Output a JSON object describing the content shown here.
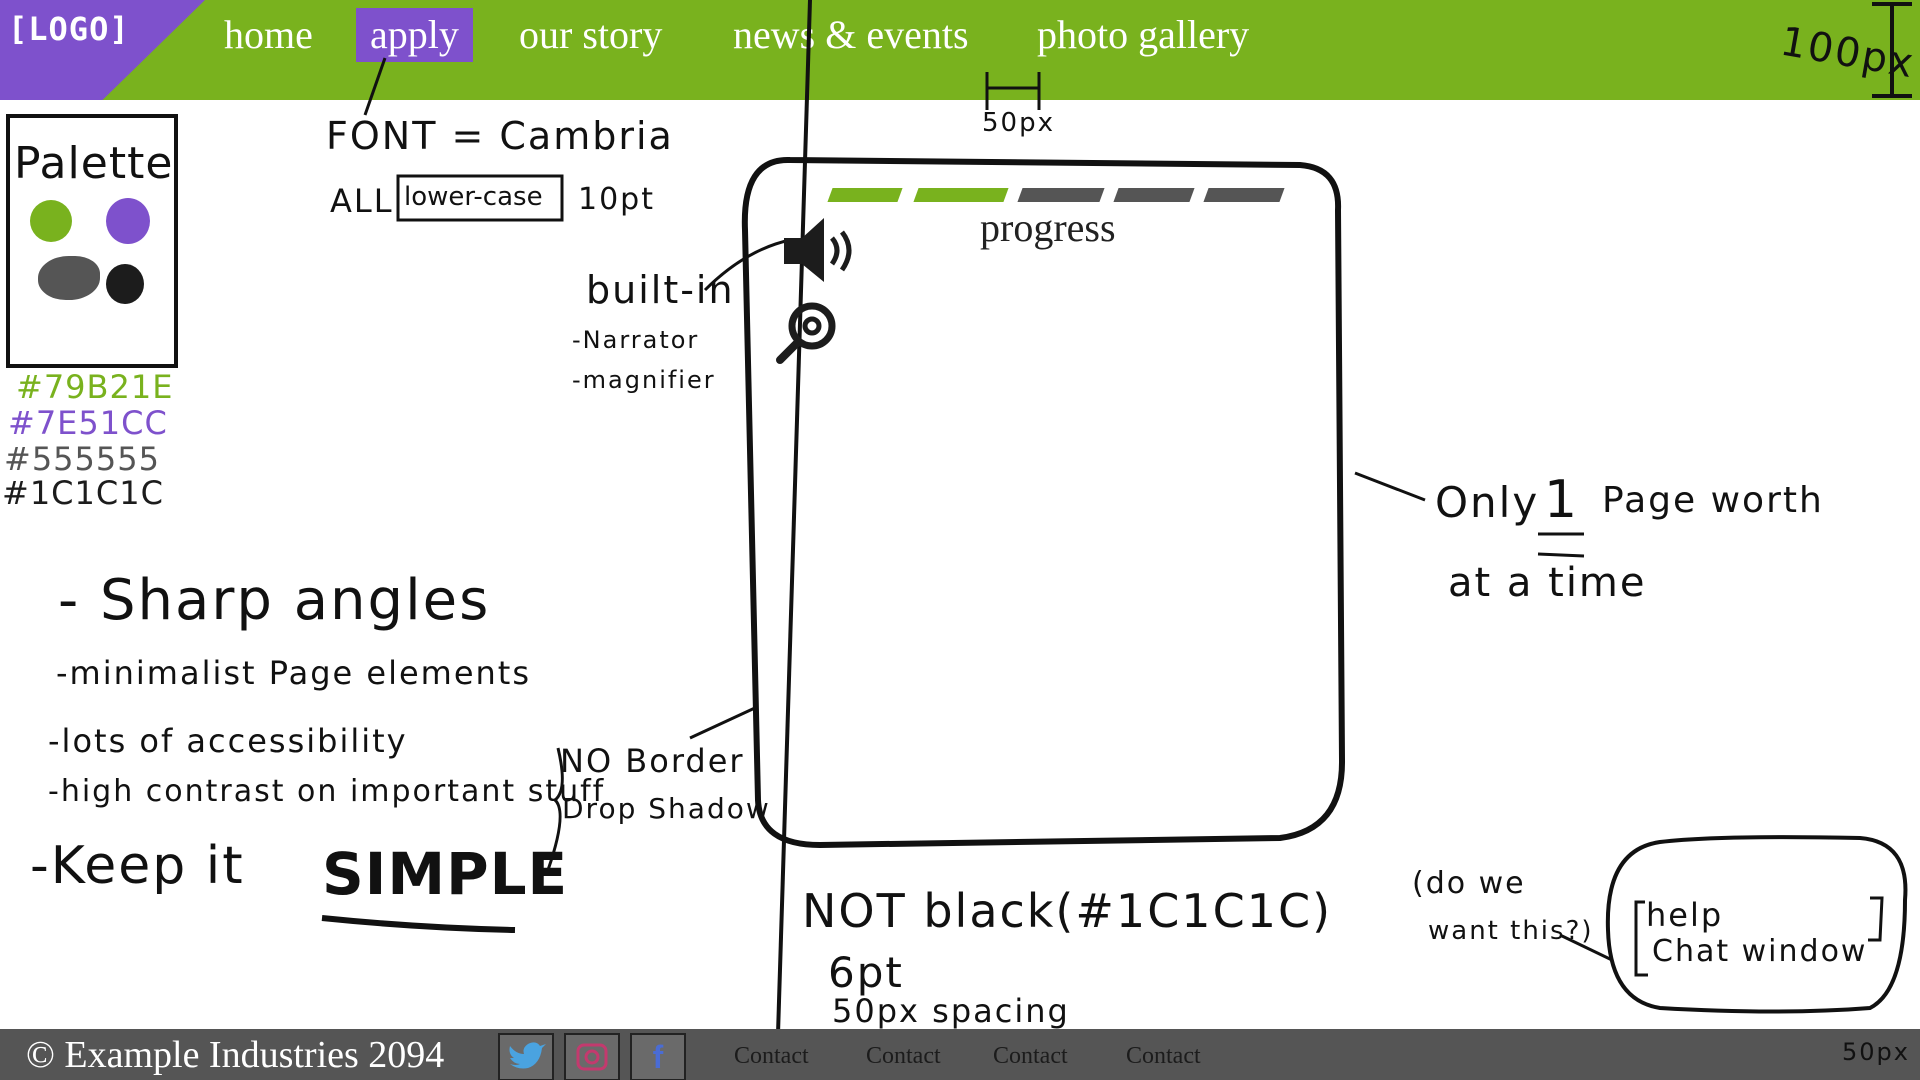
{
  "header": {
    "logo_text": "[LOGO]",
    "nav": [
      "home",
      "apply",
      "our story",
      "news & events",
      "photo gallery"
    ],
    "active_index": 1,
    "height_note": "100px",
    "spacing_note": "50px"
  },
  "colors": {
    "green": "#79B21E",
    "purple": "#7E51CC",
    "gray": "#555555",
    "black": "#1C1C1C"
  },
  "palette": {
    "title": "Palette",
    "hex_values": [
      "#79B21E",
      "#7E51CC",
      "#555555",
      "#1C1C1C"
    ]
  },
  "font_note": {
    "line1": "FONT = Cambria",
    "line2_prefix": "ALL",
    "line2_boxed": "lower-case",
    "line2_suffix": "10pt"
  },
  "builtin": {
    "title": "built-in",
    "items": [
      "-Narrator",
      "-magnifier"
    ]
  },
  "page": {
    "progress_label": "progress",
    "progress_segments": 5,
    "progress_filled": 2
  },
  "side_note": {
    "line1_prefix": "Only",
    "line1_emph": "1",
    "line1_suffix": "Page worth",
    "line2": "at a time"
  },
  "principles": [
    "- Sharp angles",
    "-minimalist Page elements",
    "-lots of accessibility",
    "-high contrast on important stuff"
  ],
  "keep_simple": {
    "prefix": "-Keep it",
    "emph": "SIMPLE"
  },
  "border_note": {
    "line1": "NO Border",
    "line2": "Drop Shadow"
  },
  "not_black": "NOT black(#1C1C1C)",
  "spacing_note": {
    "line1": "6pt",
    "line2": "50px spacing"
  },
  "chat": {
    "question_line1": "(do we",
    "question_line2": "want this?)",
    "box_line1": "help",
    "box_line2": "Chat window"
  },
  "footer": {
    "copyright": "© Example Industries 2094",
    "social_icons": [
      "twitter-icon",
      "instagram-icon",
      "facebook-icon"
    ],
    "contacts": [
      "Contact",
      "Contact",
      "Contact",
      "Contact"
    ],
    "height_note": "50px"
  }
}
